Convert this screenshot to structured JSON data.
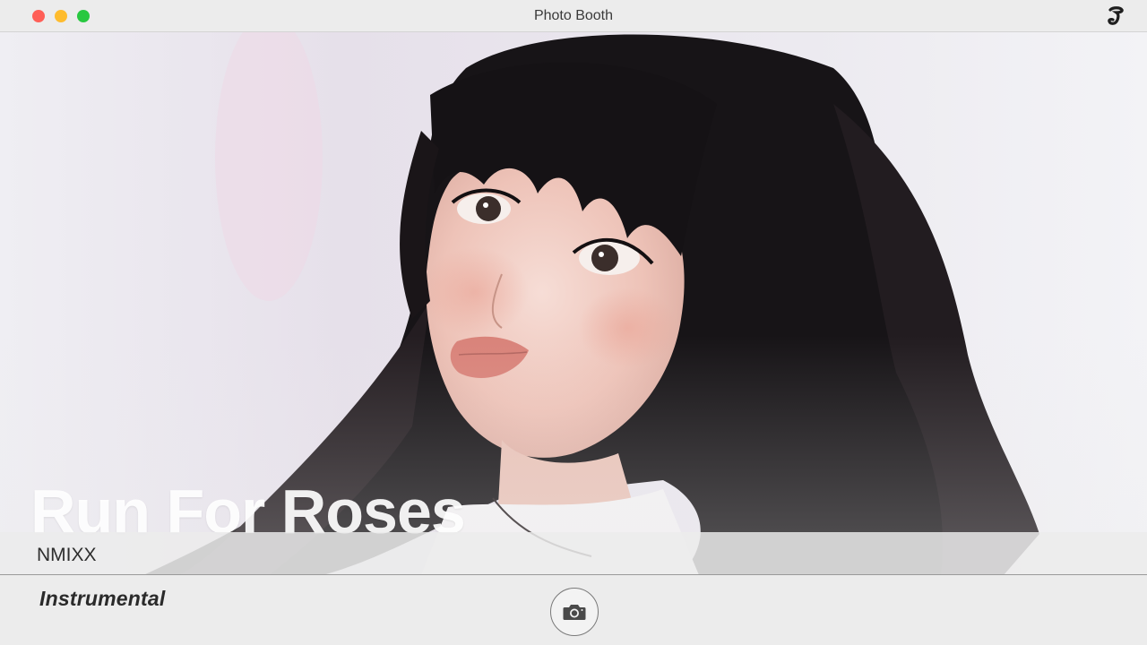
{
  "window": {
    "title": "Photo Booth"
  },
  "icons": {
    "close": "traffic-light-close",
    "minimize": "traffic-light-minimize",
    "maximize": "traffic-light-maximize",
    "brand": "brand-logo-icon",
    "shutter": "camera-icon"
  },
  "photo": {
    "song_title": "Run For Roses"
  },
  "artist": {
    "name": "NMIXX"
  },
  "toolbar": {
    "version_label": "Instrumental"
  },
  "colors": {
    "close": "#ff5f57",
    "minimize": "#febc2e",
    "maximize": "#28c840",
    "window_bg": "#ececec"
  }
}
